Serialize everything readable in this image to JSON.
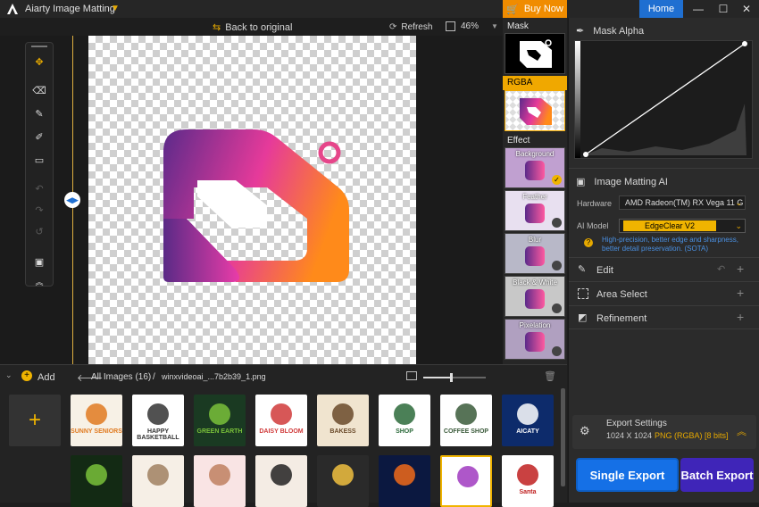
{
  "app": {
    "title": "Aiarty Image Matting"
  },
  "titlebar": {
    "buy_now": "Buy Now",
    "home": "Home",
    "minimize": "—",
    "maximize": "☐",
    "close": "✕"
  },
  "toolbar": {
    "back_to_original": "Back to original",
    "refresh": "Refresh",
    "zoom": "46%"
  },
  "strip": {
    "mask": "Mask",
    "rgba": "RGBA",
    "effect": "Effect",
    "effects": [
      "Background",
      "Feather",
      "Blur",
      "Black & White",
      "Pixelation"
    ]
  },
  "mask_alpha": {
    "title": "Mask Alpha"
  },
  "matting": {
    "title": "Image Matting AI",
    "hardware_label": "Hardware",
    "hardware_value": "AMD Radeon(TM) RX Vega 11 G",
    "model_label": "AI Model",
    "model_value": "EdgeClear  V2",
    "model_desc": "High-precision, better edge and sharpness, better detail preservation. (SOTA)"
  },
  "sections": [
    {
      "label": "Edit"
    },
    {
      "label": "Area Select"
    },
    {
      "label": "Refinement"
    }
  ],
  "export": {
    "title": "Export Settings",
    "size": "1024 X 1024",
    "format": "PNG (RGBA) [8 bits]",
    "single": "Single Export",
    "batch": "Batch Export"
  },
  "gallery": {
    "add": "Add",
    "all_images": "All Images (16)",
    "sep": "/",
    "file": "winxvideoai_...7b2b39_1.png"
  },
  "thumb_texts": [
    "SUNNY SENIORS",
    "HAPPY BASKETBALL",
    "GREEN EARTH",
    "DAISY BLOOM",
    "BAKESS",
    "SHOP",
    "COFFEE SHOP",
    "AICATY",
    "",
    "",
    "",
    "",
    "",
    "",
    "",
    "Santa"
  ],
  "colors": {
    "accent": "#f08c00",
    "brand_blue": "#1f6fd1",
    "model_yellow": "#f0b400"
  }
}
